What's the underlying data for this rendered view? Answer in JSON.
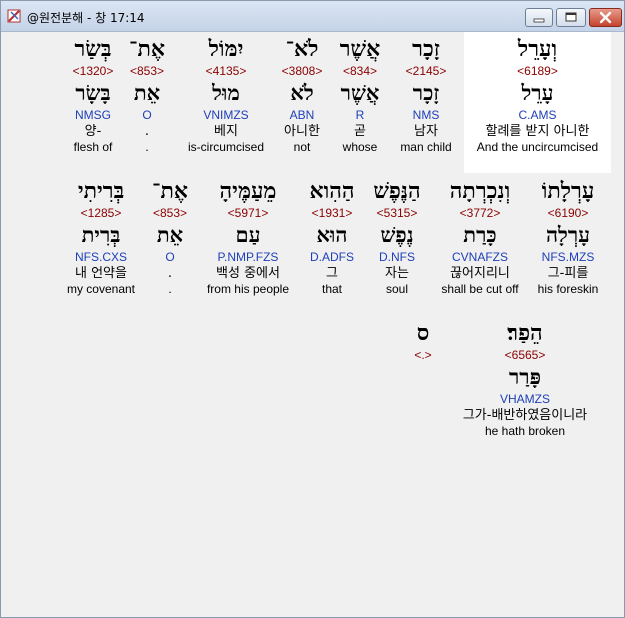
{
  "window": {
    "title": "@원전분해 - 창 17:14"
  },
  "rows": [
    {
      "words": [
        {
          "heb": "וְעָרֵל",
          "strong": "<6189>",
          "heb2": "עָרֵל",
          "morph": "C.AMS",
          "kor": "할례를 받지 아니한",
          "eng": "And the uncircumcised"
        },
        {
          "heb": "זָכָר",
          "strong": "<2145>",
          "heb2": "זָכָר",
          "morph": "NMS",
          "kor": "남자",
          "eng": "man child"
        },
        {
          "heb": "אֲשֶׁר",
          "strong": "<834>",
          "heb2": "אֲשֶׁר",
          "morph": "R",
          "kor": "곧",
          "eng": "whose"
        },
        {
          "heb": "לֹא־",
          "strong": "<3808>",
          "heb2": "לֹא",
          "morph": "ABN",
          "kor": "아니한",
          "eng": "not"
        },
        {
          "heb": "יִמּוֹל",
          "strong": "<4135>",
          "heb2": "מוּל",
          "morph": "VNIMZS",
          "kor": "베지",
          "eng": "is-circumcised"
        },
        {
          "heb": "אֶת־",
          "strong": "<853>",
          "heb2": "אֵת",
          "morph": "O",
          "kor": ".",
          "eng": "."
        },
        {
          "heb": "בְּשַׂר",
          "strong": "<1320>",
          "heb2": "בָּשָׂר",
          "morph": "NMSG",
          "kor": "양-",
          "eng": "flesh of"
        }
      ]
    },
    {
      "words": [
        {
          "heb": "עָרְלָתוֹ",
          "strong": "<6190>",
          "heb2": "עָרְלָה",
          "morph": "NFS.MZS",
          "kor": "그-피를",
          "eng": "his foreskin"
        },
        {
          "heb": "וְנִכְרְתָה",
          "strong": "<3772>",
          "heb2": "כָּרַת",
          "morph": "CVNAFZS",
          "kor": "끊어지리니",
          "eng": "shall be cut off"
        },
        {
          "heb": "הַנֶּפֶשׁ",
          "strong": "<5315>",
          "heb2": "נֶפֶשׁ",
          "morph": "D.NFS",
          "kor": "자는",
          "eng": "soul"
        },
        {
          "heb": "הַהִוא",
          "strong": "<1931>",
          "heb2": "הוּא",
          "morph": "D.ADFS",
          "kor": "그",
          "eng": "that"
        },
        {
          "heb": "מֵעַמֶּיהָ",
          "strong": "<5971>",
          "heb2": "עַם",
          "morph": "P.NMP.FZS",
          "kor": "백성 중에서",
          "eng": "from his people"
        },
        {
          "heb": "אֶת־",
          "strong": "<853>",
          "heb2": "אֵת",
          "morph": "O",
          "kor": ".",
          "eng": "."
        },
        {
          "heb": "בְּרִיתִי",
          "strong": "<1285>",
          "heb2": "בְּרִית",
          "morph": "NFS.CXS",
          "kor": "내 언약을",
          "eng": "my covenant"
        }
      ]
    },
    {
      "words": [
        {
          "heb": "הֵפַר׃",
          "strong": "<6565>",
          "heb2": "פָּרַר",
          "morph": "VHAMZS",
          "kor": "그가-배반하였음이니라",
          "eng": "he hath broken"
        },
        {
          "heb": "ס",
          "strong": "<.>",
          "heb2": "",
          "morph": "",
          "kor": "",
          "eng": ""
        }
      ]
    }
  ]
}
